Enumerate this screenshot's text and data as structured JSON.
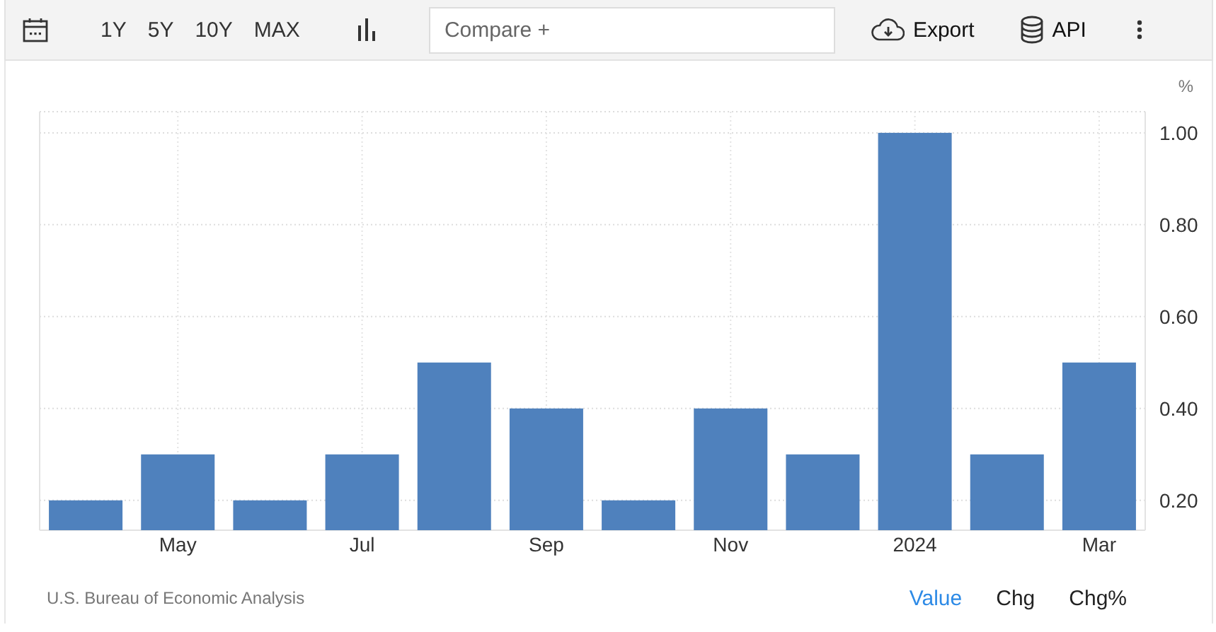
{
  "toolbar": {
    "periods": [
      "1Y",
      "5Y",
      "10Y",
      "MAX"
    ],
    "compare": {
      "placeholder": "Compare +"
    },
    "export_label": "Export",
    "api_label": "API"
  },
  "chart": {
    "unit": "%",
    "chart_data": {
      "type": "bar",
      "values": [
        0.2,
        0.3,
        0.2,
        0.3,
        0.5,
        0.4,
        0.2,
        0.4,
        0.3,
        1.0,
        0.3,
        0.5
      ],
      "color": "#4f81bd",
      "ylim": [
        0.135,
        1.046
      ],
      "yticks": [
        {
          "value": 0.2,
          "label": "0.20"
        },
        {
          "value": 0.4,
          "label": "0.40"
        },
        {
          "value": 0.6,
          "label": "0.60"
        },
        {
          "value": 0.8,
          "label": "0.80"
        },
        {
          "value": 1.0,
          "label": "1.00"
        }
      ],
      "categories": [
        null,
        "May",
        null,
        "Jul",
        null,
        "Sep",
        null,
        "Nov",
        null,
        "2024",
        null,
        "Mar"
      ],
      "grid": true
    }
  },
  "footer": {
    "source": "U.S. Bureau of Economic Analysis",
    "tabs": [
      {
        "label": "Value",
        "selected": true
      },
      {
        "label": "Chg",
        "selected": false
      },
      {
        "label": "Chg%",
        "selected": false
      }
    ]
  }
}
